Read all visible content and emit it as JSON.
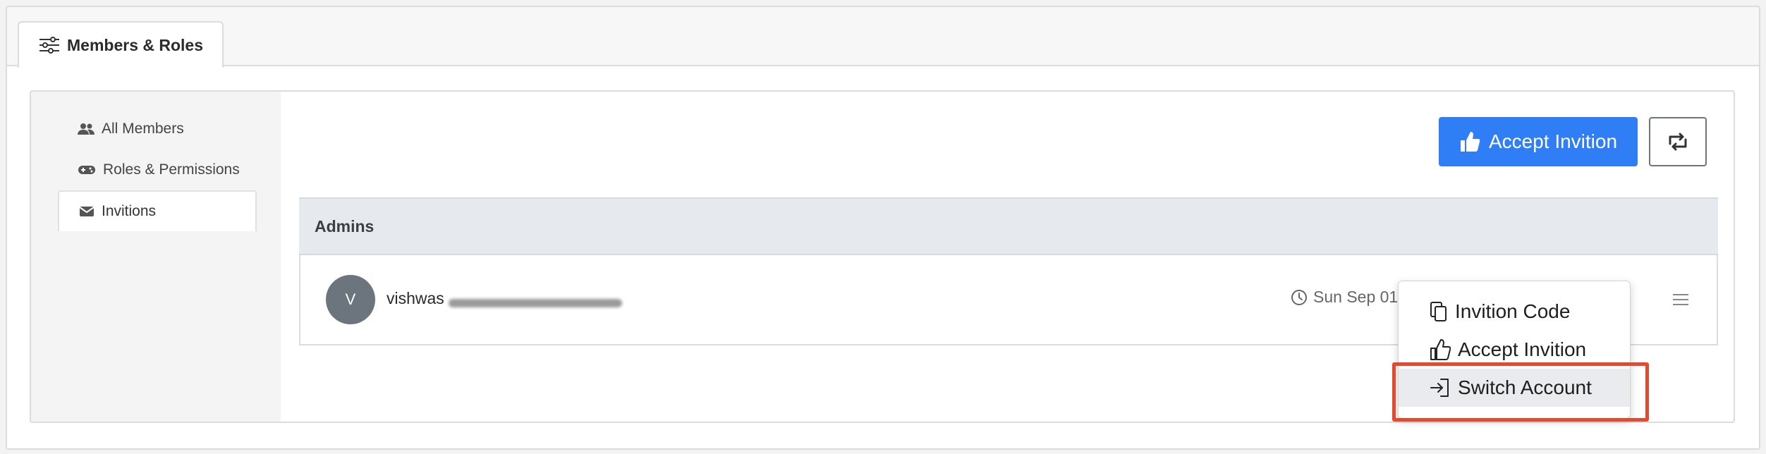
{
  "tabs": {
    "active_label": "Members & Roles"
  },
  "sidebar": {
    "items": [
      {
        "label": "All Members",
        "icon": "users-icon"
      },
      {
        "label": "Roles & Permissions",
        "icon": "gamepad-icon"
      },
      {
        "label": "Invitions",
        "icon": "envelope-icon",
        "active": true
      }
    ]
  },
  "toolbar": {
    "accept_label": "Accept Invition"
  },
  "group": {
    "title": "Admins"
  },
  "members": [
    {
      "avatar_letter": "V",
      "email": "vishwas",
      "date": "Sun Sep 01"
    }
  ],
  "dropdown": {
    "items": [
      {
        "label": "Invition Code",
        "icon": "copy-icon"
      },
      {
        "label": "Accept Invition",
        "icon": "thumbs-up-icon"
      },
      {
        "label": "Switch Account",
        "icon": "sign-in-icon"
      }
    ]
  },
  "colors": {
    "primary": "#2f7ef5",
    "highlight": "#e44a2f",
    "avatar": "#6c757d"
  }
}
